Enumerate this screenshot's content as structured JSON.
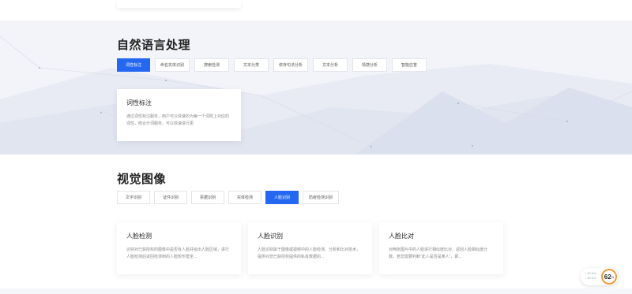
{
  "nlp": {
    "title": "自然语言处理",
    "tabs": [
      {
        "label": "词性标注",
        "active": true
      },
      {
        "label": "命名实体识别",
        "active": false
      },
      {
        "label": "搜索检测",
        "active": false
      },
      {
        "label": "文本分类",
        "active": false
      },
      {
        "label": "依存句法分析",
        "active": false
      },
      {
        "label": "文本分析",
        "active": false
      },
      {
        "label": "情感分析",
        "active": false
      },
      {
        "label": "智能应答",
        "active": false
      }
    ],
    "card": {
      "title": "词性标注",
      "desc": "通过词性标注服务，用户可以快速的为每一个词附上对应的词性，结合分词服务，可以快速进行更"
    }
  },
  "cv": {
    "title": "视觉图像",
    "tabs": [
      {
        "label": "文字识别",
        "active": false
      },
      {
        "label": "证件识别",
        "active": false
      },
      {
        "label": "票据识别",
        "active": false
      },
      {
        "label": "实体检测",
        "active": false
      },
      {
        "label": "人脸识别",
        "active": true
      },
      {
        "label": "防疫检测识别",
        "active": false
      }
    ],
    "cards": [
      {
        "title": "人脸检测",
        "desc": "识别对已获授权的图像中是否有人脸并给出人脸区域，进行人脸检测后返回检测到的人脸矩形框坐..."
      },
      {
        "title": "人脸识别",
        "desc": "人脸识别属于图像或视频中的人脸检测、分析和比对技术，提供对您已获授权提供的私有数据的..."
      },
      {
        "title": "人脸比对",
        "desc": "对两张图片中的人脸进行相似度比对，返回人脸相似度分数。若您需要判断“此人是否是某人”，即..."
      }
    ]
  },
  "widget": {
    "up": "↑ 33  K/s",
    "down": "↓ 38  K/s",
    "percent": "62",
    "percent_unit": "%"
  }
}
